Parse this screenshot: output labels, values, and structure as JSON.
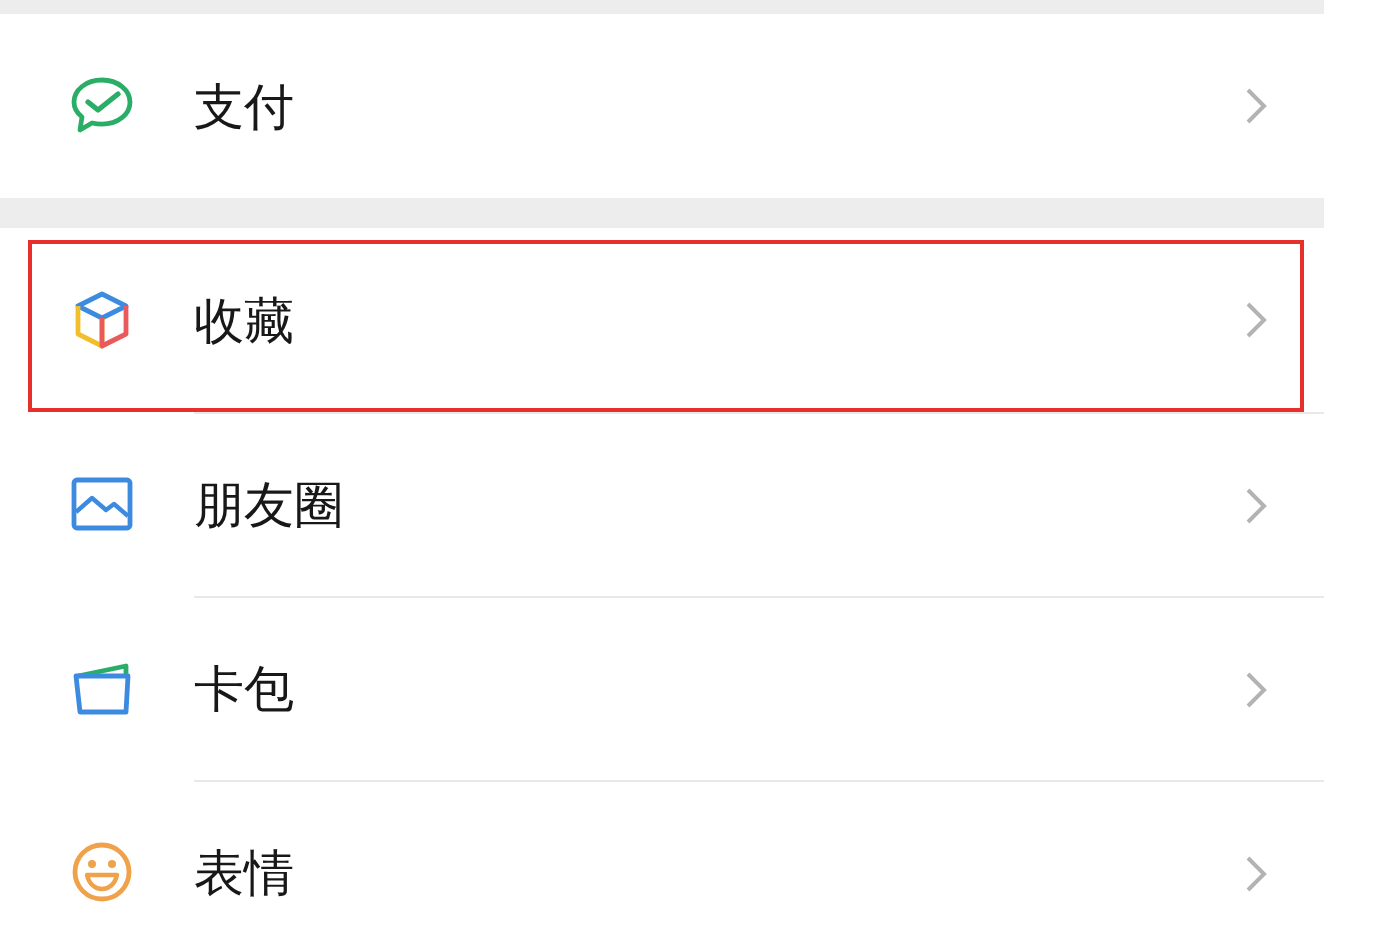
{
  "sections": [
    {
      "items": [
        {
          "label": "支付",
          "highlighted": false
        }
      ]
    },
    {
      "items": [
        {
          "label": "收藏",
          "highlighted": true
        },
        {
          "label": "朋友圈",
          "highlighted": false
        },
        {
          "label": "卡包",
          "highlighted": false
        },
        {
          "label": "表情",
          "highlighted": false
        }
      ]
    }
  ]
}
